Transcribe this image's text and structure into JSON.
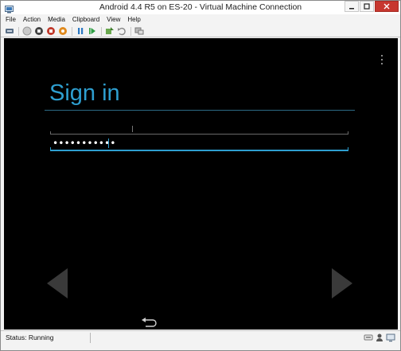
{
  "window": {
    "title": "Android 4.4 R5 on ES-20 - Virtual Machine Connection",
    "controls": [
      "minimize-icon",
      "restore-icon",
      "close-icon"
    ]
  },
  "menu": {
    "items": [
      "File",
      "Action",
      "Media",
      "Clipboard",
      "View",
      "Help"
    ]
  },
  "toolbar": {
    "icons": [
      "ctrl-alt-del-icon",
      "start-icon",
      "turn-off-icon",
      "shut-down-icon",
      "save-icon",
      "pause-icon",
      "reset-icon",
      "checkpoint-icon",
      "revert-icon",
      "enhanced-session-icon"
    ]
  },
  "android": {
    "heading": "Sign in",
    "email_value": "",
    "password_value": "•••••••••••",
    "colors": {
      "accent": "#2e9fd0",
      "background": "#000000"
    }
  },
  "status": {
    "text": "Status: Running",
    "icons": [
      "keyboard-icon",
      "user-lock-icon",
      "display-icon"
    ]
  }
}
